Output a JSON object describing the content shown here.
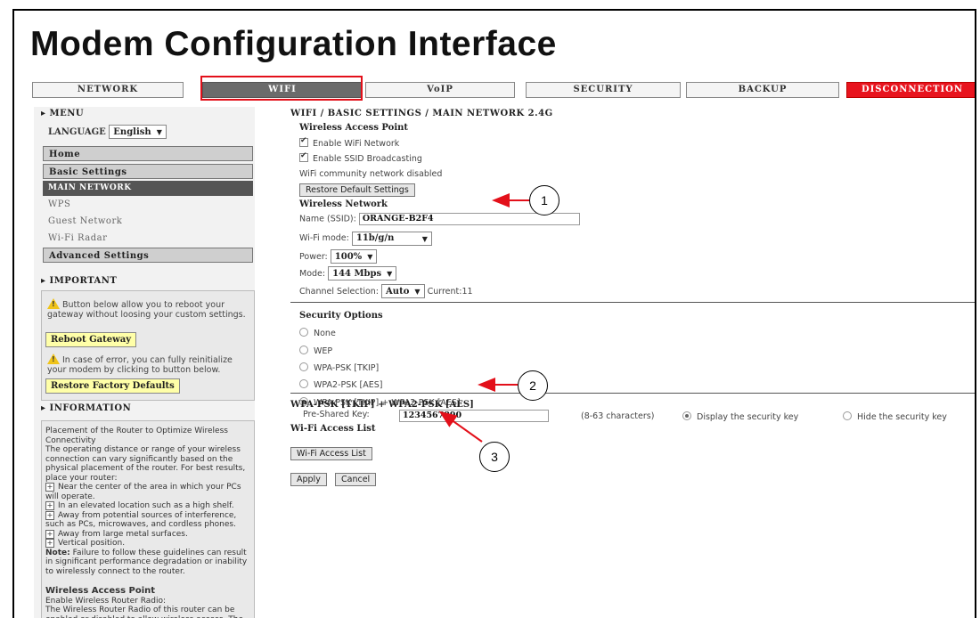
{
  "title": "Modem Configuration Interface",
  "tabs": [
    "NETWORK",
    "WIFI",
    "VoIP",
    "SECURITY",
    "BACKUP",
    "DISCONNECTION"
  ],
  "sidebar": {
    "menu_heading": "MENU",
    "language_label": "LANGUAGE",
    "language_value": "English",
    "items": {
      "home": "Home",
      "basic_settings": "Basic Settings",
      "main_network": "MAIN NETWORK",
      "wps": "WPS",
      "guest_network": "Guest Network",
      "wifi_radar": "Wi-Fi Radar",
      "advanced_settings": "Advanced Settings"
    },
    "important_heading": "IMPORTANT",
    "reboot_text": "Button below allow you to reboot your gateway without loosing your custom settings.",
    "reboot_button": "Reboot Gateway",
    "reinit_text": "In case of error, you can fully reinitialize your modem by clicking to button below.",
    "restore_button": "Restore Factory Defaults",
    "information_heading": "INFORMATION",
    "info": {
      "p1": "Placement of the Router to Optimize Wireless Connectivity",
      "p2": "The operating distance or range of your wireless connection can vary significantly based on the physical placement of the router. For best results, place your router:",
      "bullets": [
        "Near the center of the area in which your PCs will operate.",
        "In an elevated location such as a high shelf.",
        "Away from potential sources of interference, such as PCs, microwaves, and cordless phones.",
        "Away from large metal surfaces.",
        "Vertical position."
      ],
      "note_label": "Note:",
      "note": "Failure to follow these guidelines can result in significant performance degradation or inability to wirelessly connect to the router.",
      "wap_heading": "Wireless Access Point",
      "wap_sub": "Enable Wireless Router Radio:",
      "wap_text": "The Wireless Router Radio of this router can be enabled or disabled to allow wireless access. The wireless icon on the front of the"
    }
  },
  "main": {
    "breadcrumb": "WIFI / BASIC SETTINGS / MAIN NETWORK 2.4G",
    "wap_heading": "Wireless Access Point",
    "enable_wifi": "Enable WiFi Network",
    "enable_ssid": "Enable SSID Broadcasting",
    "community": "WiFi community network disabled",
    "restore_defaults": "Restore Default Settings",
    "wireless_network": "Wireless Network",
    "ssid_label": "Name (SSID):",
    "ssid_value": "ORANGE-B2F4",
    "wifi_mode_label": "Wi-Fi mode:",
    "wifi_mode_value": "11b/g/n",
    "power_label": "Power:",
    "power_value": "100%",
    "mode_label": "Mode:",
    "mode_value": "144 Mbps",
    "channel_label": "Channel Selection:",
    "channel_value": "Auto",
    "current_label": "Current:11",
    "security_heading": "Security Options",
    "security_options": [
      "None",
      "WEP",
      "WPA-PSK [TKIP]",
      "WPA2-PSK [AES]",
      "WPA-PSK [TKIP] + WPA2-PSK [AES]"
    ],
    "wpa_heading": "WPA-PSK [TKIP] + WPA2-PSK [AES]",
    "psk_label": "Pre-Shared Key:",
    "psk_value": "1234567890",
    "psk_hint": "(8-63 characters)",
    "display_key": "Display the security key",
    "hide_key": "Hide the security key",
    "access_list_heading": "Wi-Fi Access List",
    "access_list_button": "Wi-Fi Access List",
    "apply": "Apply",
    "cancel": "Cancel"
  },
  "callouts": [
    "1",
    "2",
    "3"
  ],
  "colors": {
    "highlight": "#e3101a",
    "disconnect": "#e8141e",
    "active_tab": "#6b6b6b"
  }
}
